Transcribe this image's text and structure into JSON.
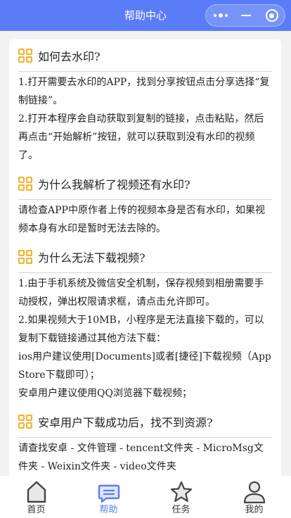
{
  "nav": {
    "title": "帮助中心",
    "color": "#5b7cf7"
  },
  "faq": [
    {
      "question": "如何去水印?",
      "paragraphs": [
        "1.打开需要去水印的APP，找到分享按钮点击分享选择“复制链接”。",
        "2.打开本程序会自动获取到复制的链接，点击粘贴，然后再点击“开始解析”按钮，就可以获取到没有水印的视频了。"
      ]
    },
    {
      "question": "为什么我解析了视频还有水印?",
      "paragraphs": [
        "请检查APP中原作者上传的视频本身是否有水印，如果视频本身有水印是暂时无法去除的。"
      ]
    },
    {
      "question": "为什么无法下载视频?",
      "paragraphs": [
        "1.由于手机系统及微信安全机制，保存视频到相册需要手动授权，弹出权限请求框，请点击允许即可。",
        "2.如果视频大于10MB，小程序是无法直接下载的，可以复制下载链接通过其他方法下载：",
        "ios用户建议使用[Documents]或者[捷径]下载视频（App Store下载即可）；",
        "安卓用户建议使用QQ浏览器下载视频；"
      ]
    },
    {
      "question": "安卓用户下载成功后，找不到资源?",
      "paragraphs": [
        "请查找安卓 - 文件管理 - tencent文件夹 - MicroMsg文件夹 - Weixin文件夹 - video文件夹"
      ]
    }
  ],
  "tabs": [
    {
      "label": "首页",
      "icon": "home-icon"
    },
    {
      "label": "帮助",
      "icon": "chat-icon",
      "active": true
    },
    {
      "label": "任务",
      "icon": "star-icon"
    },
    {
      "label": "我的",
      "icon": "user-icon"
    }
  ]
}
